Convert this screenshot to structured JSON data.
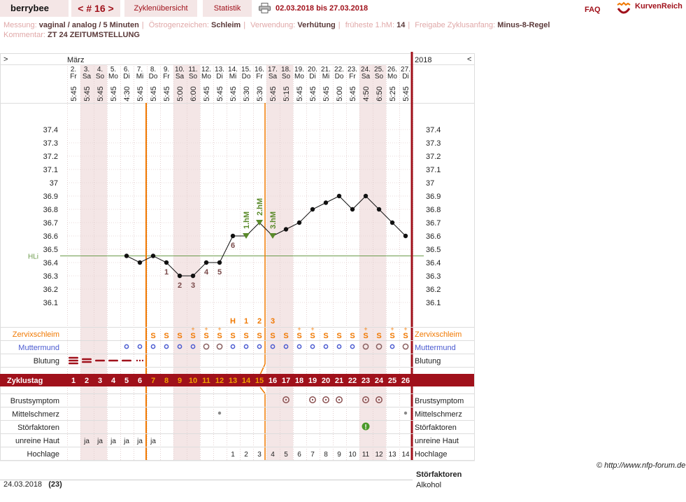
{
  "header": {
    "username": "berrybee",
    "cycle_nav": "< # 16 >",
    "tab_overview": "Zyklenübersicht",
    "tab_stats": "Statistik",
    "date_range": "02.03.2018 bis 27.03.2018",
    "faq": "FAQ",
    "logo_text": "KurvenReich"
  },
  "meta": {
    "row1": [
      {
        "label": "Messung:",
        "value": "vaginal / analog / 5 Minuten"
      },
      {
        "label": "Östrogenzeichen:",
        "value": "Schleim"
      },
      {
        "label": "Verwendung:",
        "value": "Verhütung"
      },
      {
        "label": "früheste 1.hM:",
        "value": "14"
      },
      {
        "label": "Freigabe Zyklusanfang:",
        "value": "Minus-8-Regel"
      }
    ],
    "row2": [
      {
        "label": "Kommentar:",
        "value": "ZT 24 ZEITUMSTELLUNG"
      }
    ]
  },
  "colors": {
    "accent": "#a0111b",
    "orange": "#f07800",
    "weekend_bg": "#f4e6e6",
    "coverline": "#6b9a4a",
    "hm_green": "#5a8a2a",
    "excluded_label": "#7a4a4a",
    "muttermund": "#4a5ad0"
  },
  "chart_data": {
    "type": "line",
    "title": "",
    "month_label": "März",
    "year_label": "2018",
    "left_arrow": ">",
    "right_arrow": "<",
    "y_ticks": [
      37.4,
      37.3,
      37.2,
      37.1,
      37,
      36.9,
      36.8,
      36.7,
      36.6,
      36.5,
      36.4,
      36.3,
      36.2,
      36.1
    ],
    "y_tick_labels": [
      "37.4",
      "37.3",
      "37.2",
      "37.1",
      "37",
      "36.9",
      "36.8",
      "36.7",
      "36.6",
      "36.5",
      "36.4",
      "36.3",
      "36.2",
      "36.1"
    ],
    "ylim": [
      36.05,
      37.45
    ],
    "coverline": {
      "value": 36.45,
      "label": "HLi"
    },
    "days": [
      {
        "num": "2.",
        "wd": "Fr",
        "time": "5:45",
        "cycle": "1",
        "weekend": false
      },
      {
        "num": "3.",
        "wd": "Sa",
        "time": "5:45",
        "cycle": "2",
        "weekend": true
      },
      {
        "num": "4.",
        "wd": "So",
        "time": "5:45",
        "cycle": "3",
        "weekend": true
      },
      {
        "num": "5.",
        "wd": "Mo",
        "time": "5:45",
        "cycle": "4",
        "weekend": false
      },
      {
        "num": "6.",
        "wd": "Di",
        "time": "4:30",
        "cycle": "5",
        "weekend": false
      },
      {
        "num": "7.",
        "wd": "Mi",
        "time": "5:45",
        "cycle": "6",
        "weekend": false
      },
      {
        "num": "8.",
        "wd": "Do",
        "time": "5:45",
        "cycle": "7",
        "weekend": false
      },
      {
        "num": "9.",
        "wd": "Fr",
        "time": "5:45",
        "cycle": "8",
        "weekend": false
      },
      {
        "num": "10.",
        "wd": "Sa",
        "time": "5:00",
        "cycle": "9",
        "weekend": true
      },
      {
        "num": "11.",
        "wd": "So",
        "time": "6:00",
        "cycle": "10",
        "weekend": true
      },
      {
        "num": "12.",
        "wd": "Mo",
        "time": "5:45",
        "cycle": "11",
        "weekend": false
      },
      {
        "num": "13.",
        "wd": "Di",
        "time": "5:45",
        "cycle": "12",
        "weekend": false
      },
      {
        "num": "14.",
        "wd": "Mi",
        "time": "5:45",
        "cycle": "13",
        "weekend": false
      },
      {
        "num": "15.",
        "wd": "Do",
        "time": "5:30",
        "cycle": "14",
        "weekend": false
      },
      {
        "num": "16.",
        "wd": "Fr",
        "time": "5:30",
        "cycle": "15",
        "weekend": false
      },
      {
        "num": "17.",
        "wd": "Sa",
        "time": "5:45",
        "cycle": "16",
        "weekend": true
      },
      {
        "num": "18.",
        "wd": "So",
        "time": "5:15",
        "cycle": "17",
        "weekend": true
      },
      {
        "num": "19.",
        "wd": "Mo",
        "time": "5:45",
        "cycle": "18",
        "weekend": false
      },
      {
        "num": "20.",
        "wd": "Di",
        "time": "5:45",
        "cycle": "19",
        "weekend": false
      },
      {
        "num": "21.",
        "wd": "Mi",
        "time": "5:45",
        "cycle": "20",
        "weekend": false
      },
      {
        "num": "22.",
        "wd": "Do",
        "time": "5:00",
        "cycle": "21",
        "weekend": false
      },
      {
        "num": "23.",
        "wd": "Fr",
        "time": "5:45",
        "cycle": "22",
        "weekend": false
      },
      {
        "num": "24.",
        "wd": "Sa",
        "time": "4:50",
        "cycle": "23",
        "weekend": true
      },
      {
        "num": "25.",
        "wd": "So",
        "time": "6:50",
        "cycle": "24",
        "weekend": true
      },
      {
        "num": "26.",
        "wd": "Mo",
        "time": "5:25",
        "cycle": "25",
        "weekend": false
      },
      {
        "num": "27.",
        "wd": "Di",
        "time": "5:45",
        "cycle": "26",
        "weekend": false
      }
    ],
    "series": [
      {
        "values": [
          null,
          null,
          null,
          null,
          36.45,
          36.4,
          36.45,
          36.4,
          36.3,
          36.3,
          36.4,
          36.4,
          36.6,
          36.6,
          36.7,
          36.6,
          36.65,
          36.7,
          36.8,
          36.85,
          36.9,
          36.8,
          36.9,
          36.8,
          36.7,
          36.6
        ]
      }
    ],
    "excluded_labels": [
      {
        "day": 7,
        "text": "1"
      },
      {
        "day": 8,
        "text": "2"
      },
      {
        "day": 9,
        "text": "3"
      },
      {
        "day": 10,
        "text": "4"
      },
      {
        "day": 11,
        "text": "5"
      },
      {
        "day": 12,
        "text": "6"
      }
    ],
    "hm_labels": [
      {
        "day": 13,
        "text": "1.hM"
      },
      {
        "day": 14,
        "text": "2.hM"
      },
      {
        "day": 15,
        "text": "3.hM"
      }
    ],
    "peak_labels": [
      {
        "day": 12,
        "text": "H"
      },
      {
        "day": 13,
        "text": "1"
      },
      {
        "day": 14,
        "text": "2"
      },
      {
        "day": 15,
        "text": "3"
      }
    ],
    "row_labels": {
      "zervix": "Zervixschleim",
      "muttermund": "Muttermund",
      "blutung": "Blutung",
      "zyklustag": "Zyklustag",
      "brust": "Brustsymptom",
      "mittel": "Mittelschmerz",
      "stoer": "Störfaktoren",
      "haut": "unreine Haut",
      "hoch": "Hochlage"
    },
    "zervix": [
      "",
      "",
      "",
      "",
      "",
      "",
      "S",
      "S",
      "S",
      "S+",
      "S+",
      "S+",
      "S",
      "S",
      "S",
      "S",
      "S",
      "S+",
      "S+",
      "S",
      "S",
      "S",
      "S+",
      "S",
      "S+",
      "S+"
    ],
    "muttermund": [
      "",
      "",
      "",
      "",
      "o",
      "o",
      "o",
      "o",
      "o",
      "o",
      "O",
      "O",
      "o",
      "o",
      "o",
      "o",
      "o",
      "o",
      "o",
      "o",
      "o",
      "o",
      "O",
      "O",
      "o",
      "O"
    ],
    "blutung": [
      "3",
      "2",
      "1",
      "1",
      "1",
      "0.5",
      "",
      "",
      "",
      "",
      "",
      "",
      "",
      "",
      "",
      "",
      "",
      "",
      "",
      "",
      "",
      "",
      "",
      "",
      "",
      ""
    ],
    "brust": [
      false,
      false,
      false,
      false,
      false,
      false,
      false,
      false,
      false,
      false,
      false,
      false,
      false,
      false,
      false,
      false,
      true,
      false,
      true,
      true,
      true,
      false,
      true,
      true,
      false,
      false
    ],
    "mittel": [
      false,
      false,
      false,
      false,
      false,
      false,
      false,
      false,
      false,
      false,
      false,
      true,
      false,
      false,
      false,
      false,
      false,
      false,
      false,
      false,
      false,
      false,
      false,
      false,
      false,
      true
    ],
    "stoer": [
      false,
      false,
      false,
      false,
      false,
      false,
      false,
      false,
      false,
      false,
      false,
      false,
      false,
      false,
      false,
      false,
      false,
      false,
      false,
      false,
      false,
      false,
      true,
      false,
      false,
      false
    ],
    "haut": [
      "",
      "ja",
      "ja",
      "ja",
      "ja",
      "ja",
      "ja",
      "",
      "",
      "",
      "",
      "",
      "",
      "",
      "",
      "",
      "",
      "",
      "",
      "",
      "",
      "",
      "",
      "",
      "",
      ""
    ],
    "hoch": [
      "",
      "",
      "",
      "",
      "",
      "",
      "",
      "",
      "",
      "",
      "",
      "",
      "1",
      "2",
      "3",
      "4",
      "5",
      "6",
      "7",
      "8",
      "9",
      "10",
      "11",
      "12",
      "13",
      "14"
    ]
  },
  "footer": {
    "copyright": "© http://www.nfp-forum.de",
    "date": "24.03.2018",
    "count": "(23)",
    "stoer_title": "Störfaktoren",
    "stoer_item": "Alkohol"
  }
}
